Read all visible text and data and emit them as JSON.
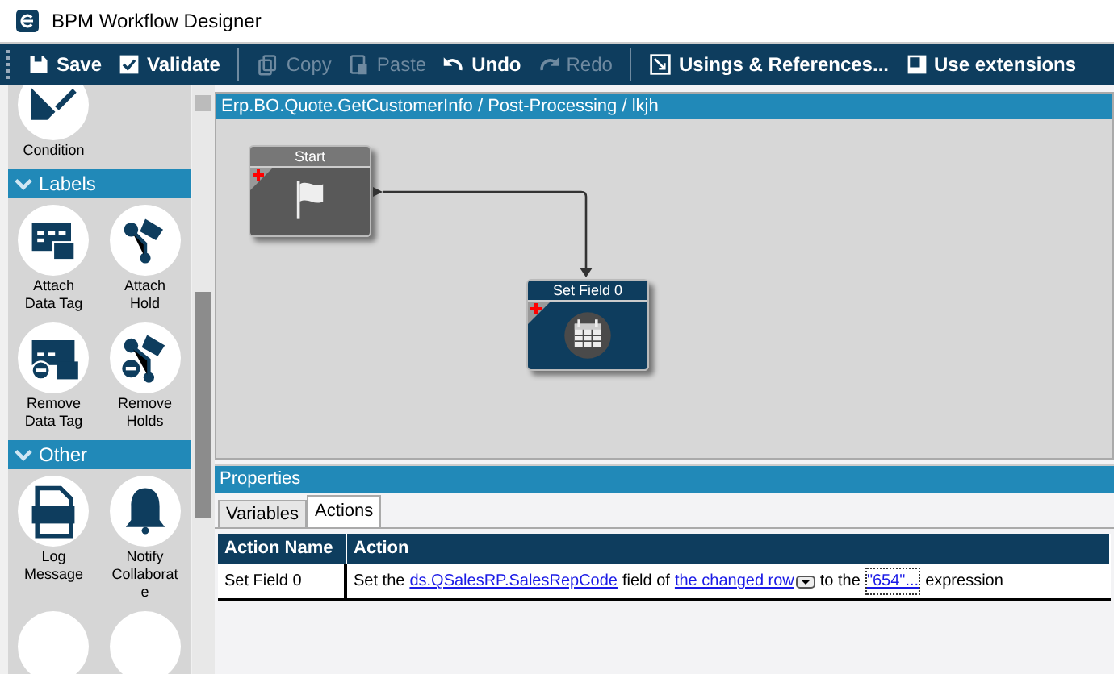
{
  "window": {
    "title": "BPM Workflow Designer"
  },
  "toolbar": [
    {
      "label": "Save",
      "kind": "save",
      "disabled": false
    },
    {
      "label": "Validate",
      "kind": "check",
      "disabled": false
    },
    {
      "label": "Copy",
      "kind": "copy",
      "disabled": true
    },
    {
      "label": "Paste",
      "kind": "paste",
      "disabled": true
    },
    {
      "label": "Undo",
      "kind": "undo",
      "disabled": false
    },
    {
      "label": "Redo",
      "kind": "redo",
      "disabled": true
    },
    {
      "label": "Usings & References...",
      "kind": "usings",
      "disabled": false
    },
    {
      "label": "Use extensions",
      "kind": "ext",
      "disabled": false
    }
  ],
  "palette": [
    {
      "items": [
        {
          "label": "Condition",
          "kind": "condition"
        }
      ]
    },
    {
      "header": "Labels",
      "expanded": true,
      "items": [
        {
          "label": "Attach Data Tag",
          "kind": "tag"
        },
        {
          "label": "Attach Hold",
          "kind": "hold"
        },
        {
          "label": "Remove Data Tag",
          "kind": "tag-remove"
        },
        {
          "label": "Remove Holds",
          "kind": "hold-remove"
        }
      ]
    },
    {
      "header": "Other",
      "expanded": true,
      "items": [
        {
          "label": "Log Message",
          "kind": "log"
        },
        {
          "label": "Notify Collaborate",
          "kind": "bell"
        }
      ]
    }
  ],
  "canvas": {
    "breadcrumb": "Erp.BO.Quote.GetCustomerInfo / Post-Processing / lkjh",
    "nodes": [
      {
        "title": "Start",
        "kind": "start"
      },
      {
        "title": "Set Field 0",
        "kind": "setfield"
      }
    ]
  },
  "properties": {
    "title": "Properties",
    "tabs": [
      {
        "label": "Variables",
        "selected": false
      },
      {
        "label": "Actions",
        "selected": true
      }
    ],
    "table": {
      "columns": [
        "Action Name",
        "Action"
      ],
      "rows": [
        {
          "name": "Set Field 0",
          "action": [
            {
              "text": "Set the",
              "kind": "plain"
            },
            {
              "text": "ds.QSalesRP.SalesRepCode",
              "kind": "link"
            },
            {
              "text": "field of",
              "kind": "plain"
            },
            {
              "text": "the changed row",
              "kind": "dropdown"
            },
            {
              "text": "to the",
              "kind": "plain"
            },
            {
              "text": "\"654\"...",
              "kind": "focused"
            },
            {
              "text": "expression",
              "kind": "plain"
            }
          ]
        }
      ]
    }
  }
}
